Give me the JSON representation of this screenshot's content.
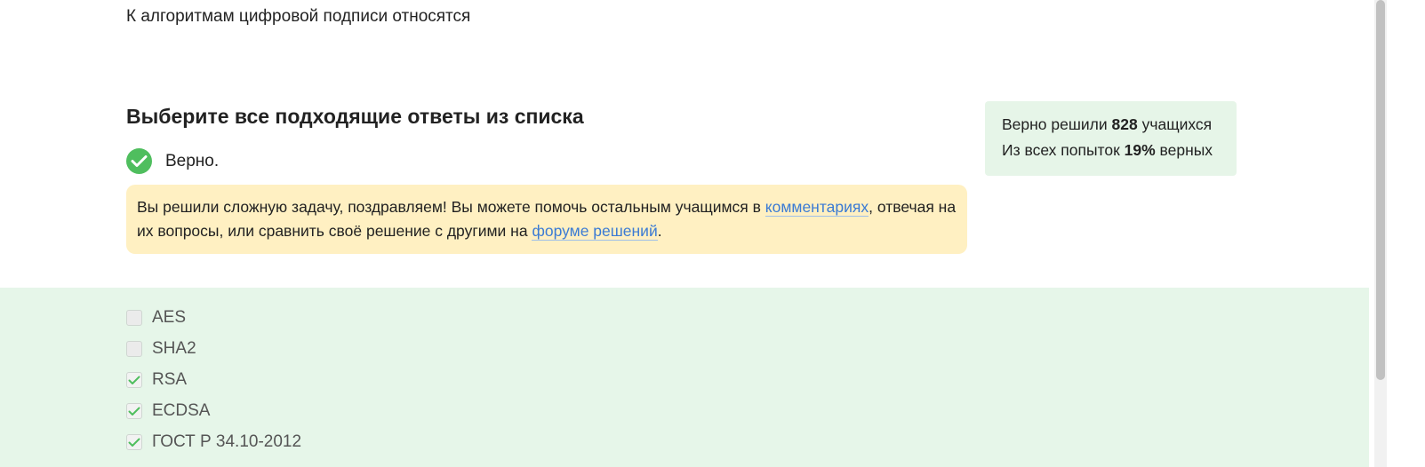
{
  "question": {
    "text": "К алгоритмам цифровой подписи относятся"
  },
  "instruction": {
    "heading": "Выберите все подходящие ответы из списка"
  },
  "result": {
    "status": "Верно.",
    "icon": "check-circle-icon",
    "status_color": "#4fbe5e"
  },
  "notice": {
    "text_before": "Вы решили сложную задачу, поздравляем! Вы можете помочь остальным учащимся в ",
    "comments_link": "комментариях",
    "text_middle": ", отвечая на их вопросы, или сравнить своё решение с другими на ",
    "forum_link": "форуме решений",
    "text_after": ".",
    "background": "#fff0c2",
    "link_color": "#3b7bd4"
  },
  "stats": {
    "line1_prefix": "Верно решили ",
    "solved_count": "828",
    "line1_suffix": " учащихся",
    "line2_prefix": "Из всех попыток ",
    "percent": "19%",
    "line2_suffix": " верных",
    "background": "#e6f5e8"
  },
  "options": [
    {
      "label": "AES",
      "checked": false
    },
    {
      "label": "SHA2",
      "checked": false
    },
    {
      "label": "RSA",
      "checked": true
    },
    {
      "label": "ECDSA",
      "checked": true
    },
    {
      "label": "ГОСТ Р 34.10-2012",
      "checked": true
    }
  ],
  "colors": {
    "options_background": "#e6f6e9",
    "checkmark": "#4fbe5e"
  }
}
